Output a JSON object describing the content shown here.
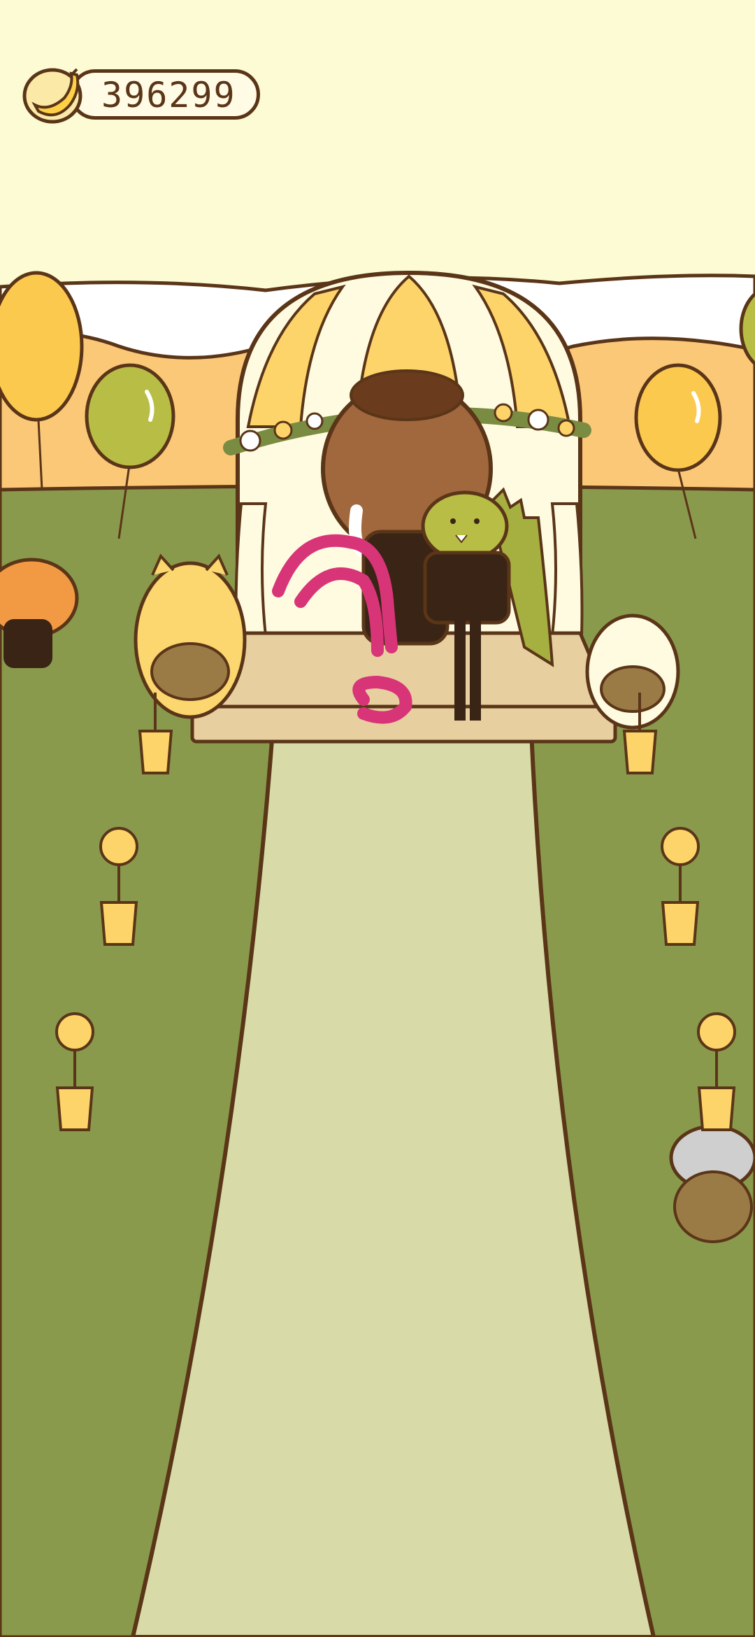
{
  "hud": {
    "currency_icon": "banana-icon",
    "currency_amount": "396299"
  },
  "colors": {
    "sky": "#fcfbd3",
    "grass": "#8a9a4c",
    "aisle": "#d8dba8",
    "outline": "#5a3518",
    "balloon_yellow": "#fcc94f",
    "balloon_green": "#b8bd45",
    "scribble": "#d83478"
  }
}
